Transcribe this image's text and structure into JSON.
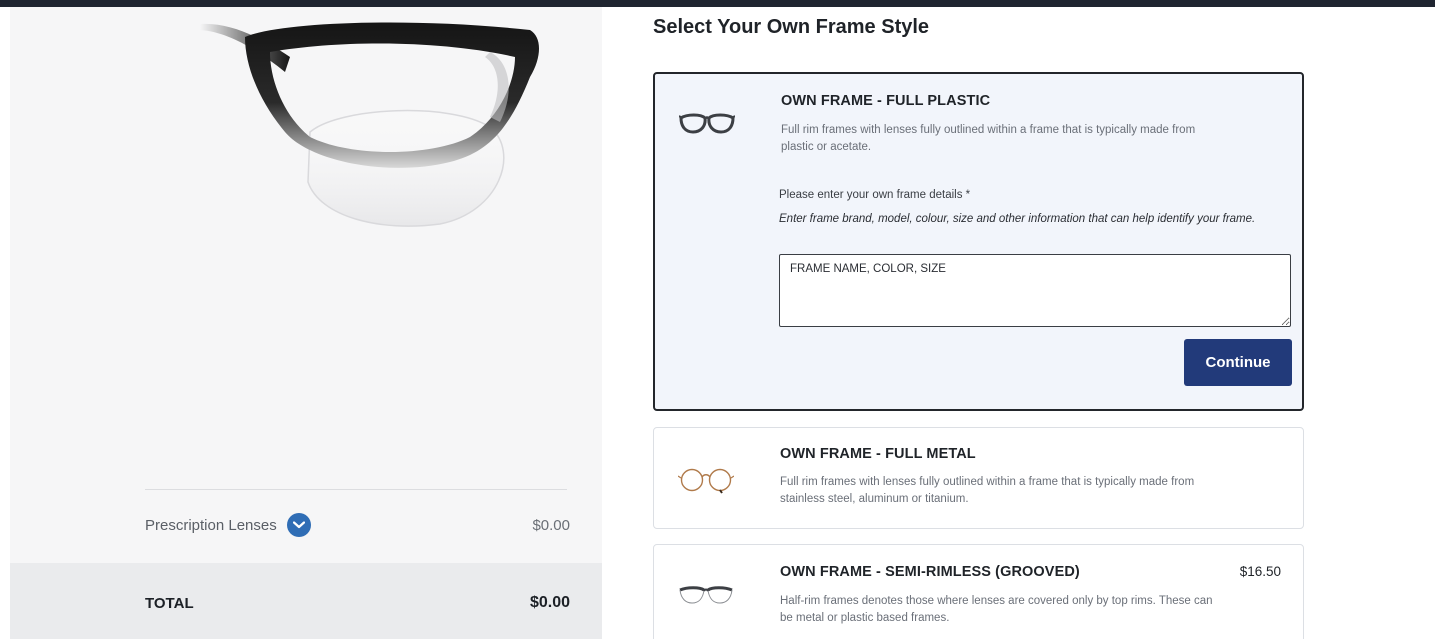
{
  "page": {
    "title": "Select Your Own Frame Style"
  },
  "summary": {
    "lenses_label": "Prescription Lenses",
    "lenses_price": "$0.00",
    "total_label": "TOTAL",
    "total_price": "$0.00"
  },
  "frame_options": [
    {
      "title": "OWN FRAME - FULL PLASTIC",
      "description": "Full rim frames with lenses fully outlined within a frame that is typically made from plastic or acetate.",
      "price": "",
      "icon": "plastic-glasses-icon",
      "selected": true
    },
    {
      "title": "OWN FRAME - FULL METAL",
      "description": "Full rim frames with lenses fully outlined within a frame that is typically made from stainless steel, aluminum or titanium.",
      "price": "",
      "icon": "metal-glasses-icon",
      "selected": false
    },
    {
      "title": "OWN FRAME - SEMI-RIMLESS (GROOVED)",
      "description": "Half-rim frames denotes those where lenses are covered only by top rims. These can be metal or plastic based frames.",
      "price": "$16.50",
      "icon": "semi-rimless-glasses-icon",
      "selected": false
    }
  ],
  "details_form": {
    "label": "Please enter your own frame details *",
    "hint": "Enter frame brand, model, colour, size and other information that can help identify your frame.",
    "value": "FRAME NAME, COLOR, SIZE",
    "continue_label": "Continue"
  },
  "colors": {
    "accent": "#223a7a",
    "chevron": "#2f6db5",
    "selected_bg": "#f2f5fb"
  }
}
